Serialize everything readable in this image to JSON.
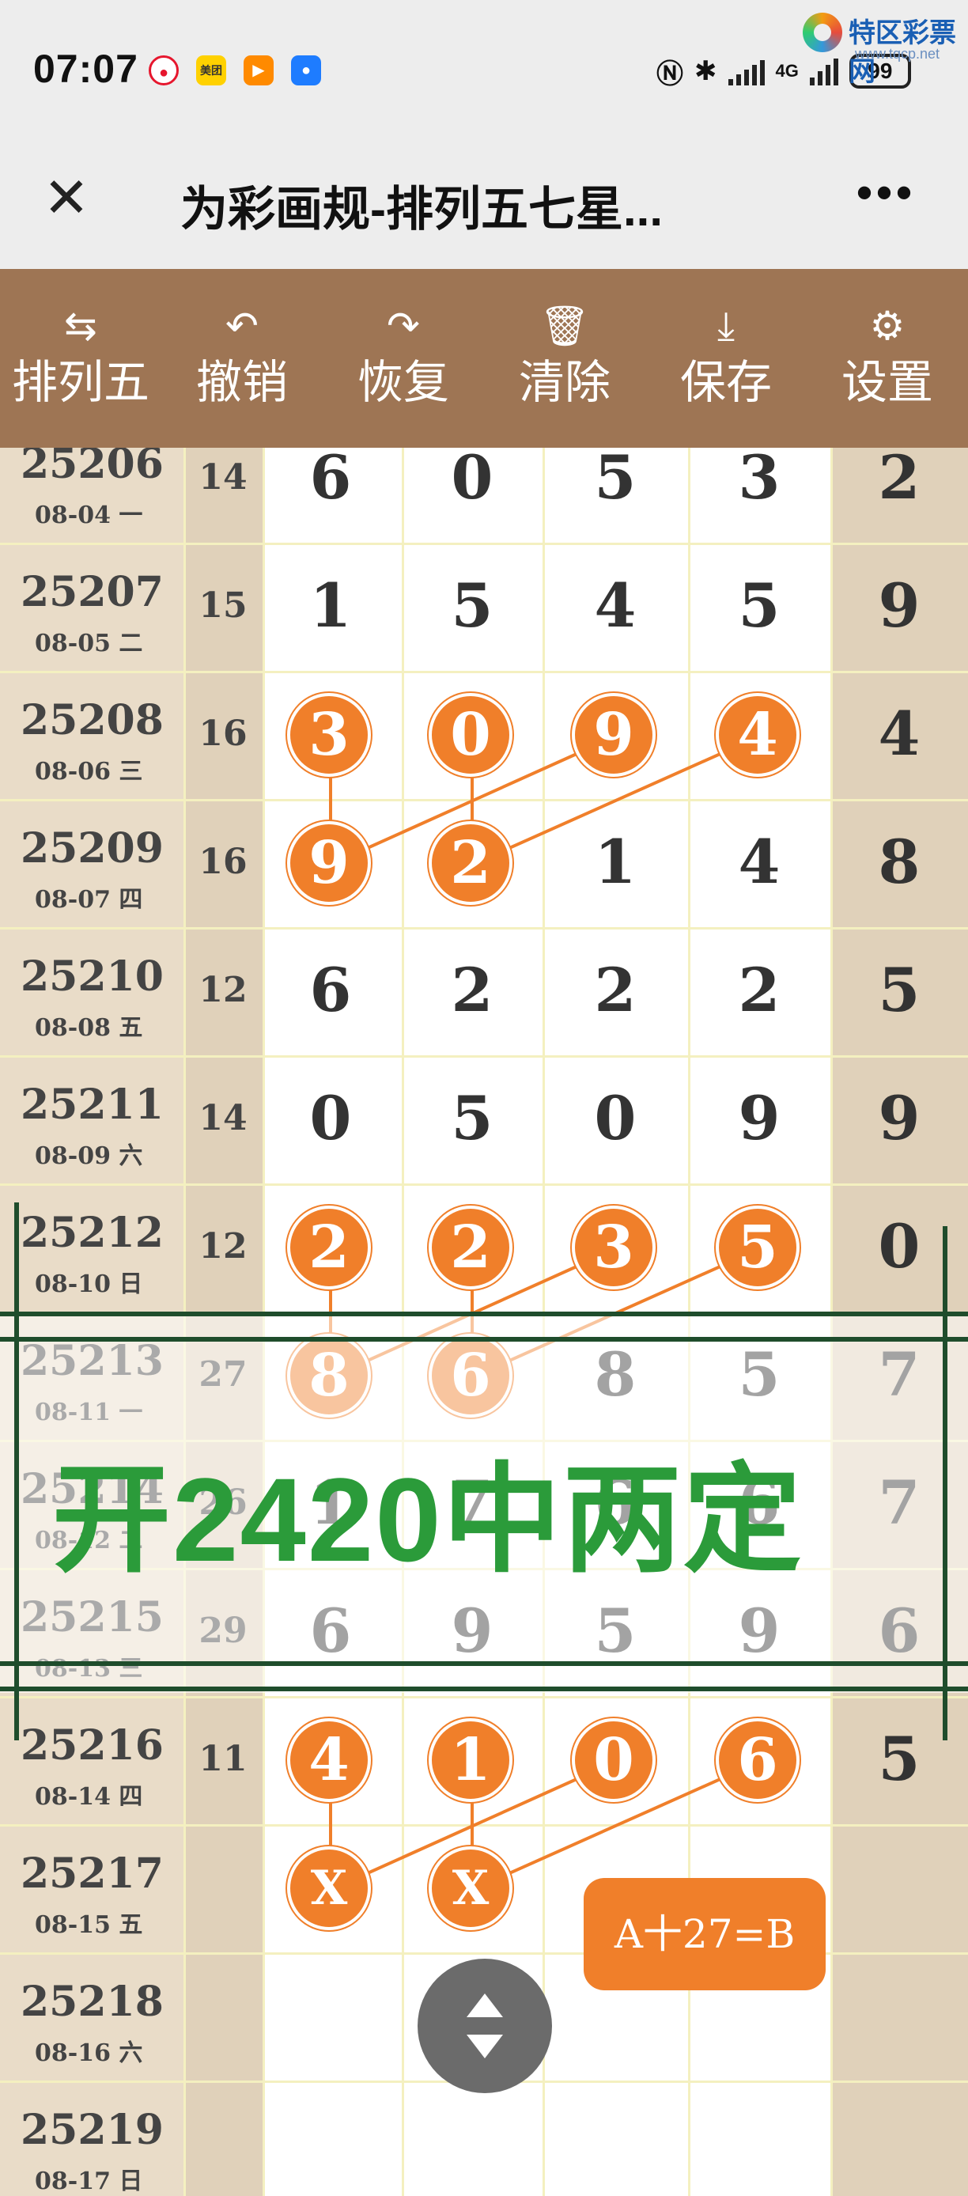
{
  "status": {
    "time": "07:07",
    "battery": "99",
    "network": "4G"
  },
  "watermark": {
    "title": "特区彩票网",
    "url": "www.tqcp.net"
  },
  "nav": {
    "title": "为彩画规-排列五七星...",
    "close": "✕",
    "more": "•••"
  },
  "toolbar": [
    {
      "label": "排列五",
      "icon": "swap-icon"
    },
    {
      "label": "撤销",
      "icon": "undo-icon"
    },
    {
      "label": "恢复",
      "icon": "redo-icon"
    },
    {
      "label": "清除",
      "icon": "trash-icon"
    },
    {
      "label": "保存",
      "icon": "download-icon"
    },
    {
      "label": "设置",
      "icon": "gear-icon"
    }
  ],
  "rows": [
    {
      "issue": "25206",
      "date": "08-04 一",
      "sum": "14",
      "digits": [
        "6",
        "0",
        "5",
        "3",
        "2"
      ]
    },
    {
      "issue": "25207",
      "date": "08-05 二",
      "sum": "15",
      "digits": [
        "1",
        "5",
        "4",
        "5",
        "9"
      ]
    },
    {
      "issue": "25208",
      "date": "08-06 三",
      "sum": "16",
      "digits": [
        "3",
        "0",
        "9",
        "4",
        "4"
      ]
    },
    {
      "issue": "25209",
      "date": "08-07 四",
      "sum": "16",
      "digits": [
        "9",
        "2",
        "1",
        "4",
        "8"
      ]
    },
    {
      "issue": "25210",
      "date": "08-08 五",
      "sum": "12",
      "digits": [
        "6",
        "2",
        "2",
        "2",
        "5"
      ]
    },
    {
      "issue": "25211",
      "date": "08-09 六",
      "sum": "14",
      "digits": [
        "0",
        "5",
        "0",
        "9",
        "9"
      ]
    },
    {
      "issue": "25212",
      "date": "08-10 日",
      "sum": "12",
      "digits": [
        "2",
        "2",
        "3",
        "5",
        "0"
      ]
    },
    {
      "issue": "25213",
      "date": "08-11 一",
      "sum": "27",
      "digits": [
        "8",
        "6",
        "8",
        "5",
        "7"
      ]
    },
    {
      "issue": "25214",
      "date": "08-12 二",
      "sum": "26",
      "digits": [
        "1",
        "7",
        "6",
        "6",
        "7"
      ]
    },
    {
      "issue": "25215",
      "date": "08-13 三",
      "sum": "29",
      "digits": [
        "6",
        "9",
        "5",
        "9",
        "6"
      ]
    },
    {
      "issue": "25216",
      "date": "08-14 四",
      "sum": "11",
      "digits": [
        "4",
        "1",
        "0",
        "6",
        "5"
      ]
    },
    {
      "issue": "25217",
      "date": "08-15 五",
      "sum": "",
      "digits": [
        "X",
        "X",
        "",
        "",
        ""
      ]
    },
    {
      "issue": "25218",
      "date": "08-16 六",
      "sum": "",
      "digits": [
        "",
        "",
        "",
        "",
        ""
      ]
    },
    {
      "issue": "25219",
      "date": "08-17 日",
      "sum": "",
      "digits": [
        "",
        "",
        "",
        "",
        ""
      ]
    }
  ],
  "overlay_text": "开2420中两定",
  "formula_button": "A十27=B"
}
